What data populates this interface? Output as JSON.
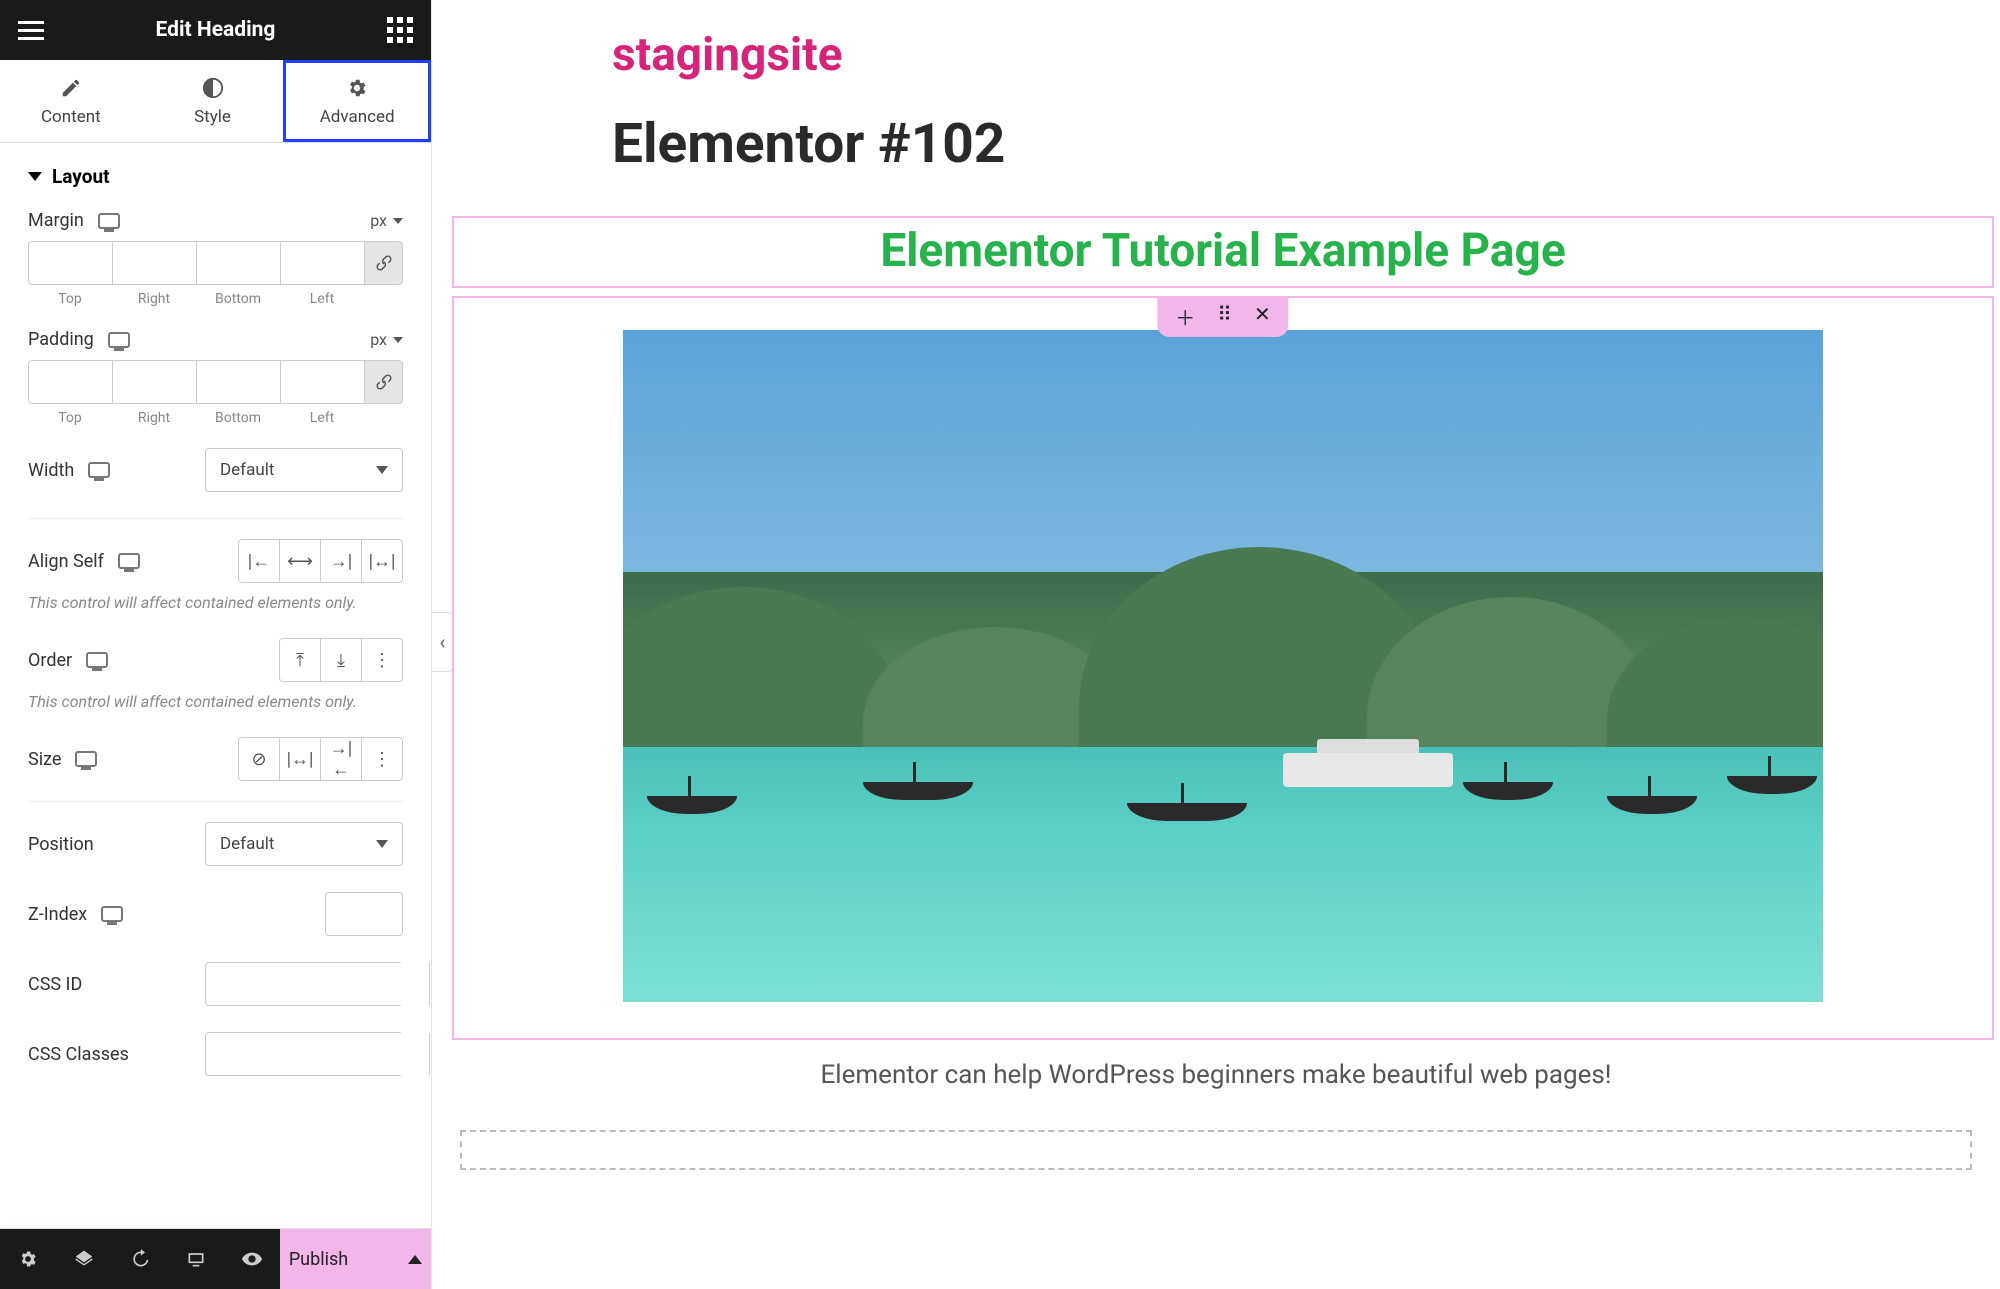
{
  "panel": {
    "title": "Edit Heading",
    "tabs": {
      "content": "Content",
      "style": "Style",
      "advanced": "Advanced",
      "active": "advanced"
    },
    "layout": {
      "section_label": "Layout",
      "margin": {
        "label": "Margin",
        "unit": "px",
        "sides": [
          "Top",
          "Right",
          "Bottom",
          "Left"
        ]
      },
      "padding": {
        "label": "Padding",
        "unit": "px",
        "sides": [
          "Top",
          "Right",
          "Bottom",
          "Left"
        ]
      },
      "width": {
        "label": "Width",
        "value": "Default"
      },
      "align_self": {
        "label": "Align Self",
        "note": "This control will affect contained elements only."
      },
      "order": {
        "label": "Order",
        "note": "This control will affect contained elements only."
      },
      "size": {
        "label": "Size"
      },
      "position": {
        "label": "Position",
        "value": "Default"
      },
      "zindex": {
        "label": "Z-Index"
      },
      "css_id": {
        "label": "CSS ID"
      },
      "css_classes": {
        "label": "CSS Classes"
      }
    },
    "footer": {
      "publish": "Publish"
    }
  },
  "canvas": {
    "site_title": "stagingsite",
    "page_title": "Elementor #102",
    "heading_text": "Elementor Tutorial Example Page",
    "caption": "Elementor can help WordPress beginners make beautiful web pages!"
  }
}
